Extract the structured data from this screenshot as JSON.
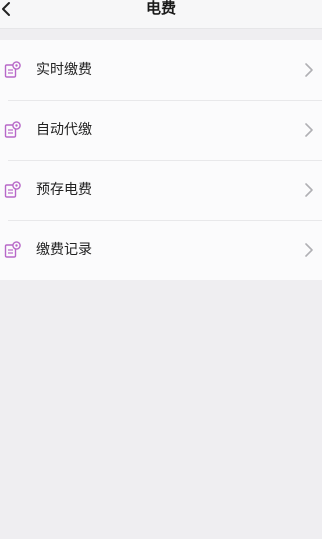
{
  "header": {
    "title": "电费",
    "back_icon": "chevron-left-icon"
  },
  "menu": {
    "items": [
      {
        "label": "实时缴费",
        "icon": "bill-document-icon"
      },
      {
        "label": "自动代缴",
        "icon": "bill-document-icon"
      },
      {
        "label": "预存电费",
        "icon": "bill-document-icon"
      },
      {
        "label": "缴费记录",
        "icon": "bill-document-icon"
      }
    ]
  },
  "colors": {
    "icon_accent": "#b768c8",
    "chevron": "#b0b0b4",
    "background": "#efeef1"
  }
}
